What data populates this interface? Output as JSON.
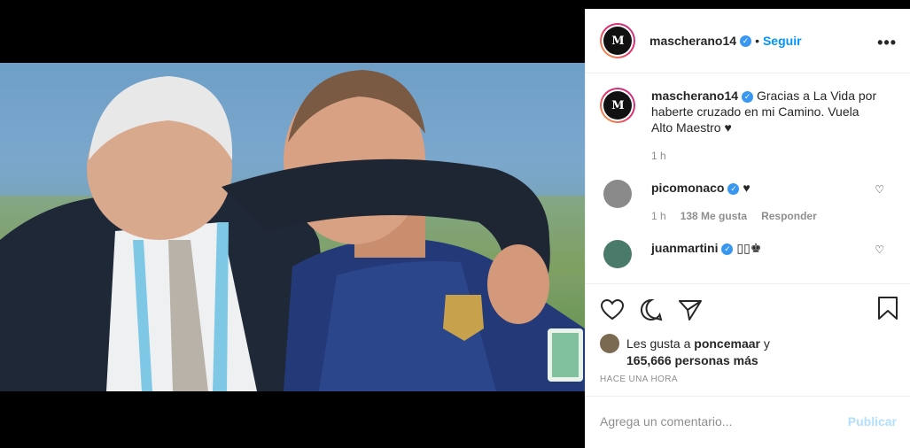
{
  "header": {
    "avatar_text": "M",
    "username": "mascherano14",
    "separator": "•",
    "follow_label": "Seguir",
    "more_label": "•••"
  },
  "caption": {
    "username": "mascherano14",
    "text": "Gracias a La Vida por haberte cruzado en mi Camino. Vuela Alto Maestro ♥",
    "time": "1 h"
  },
  "comments": [
    {
      "username": "picomonaco",
      "text": "♥",
      "time": "1 h",
      "likes": "138 Me gusta",
      "reply": "Responder"
    },
    {
      "username": "juanmartini",
      "text": "▯▯♚"
    }
  ],
  "likes": {
    "prefix": "Les gusta a ",
    "user": "poncemaar",
    "connector": " y",
    "count": "165,666 personas más"
  },
  "posted_time": "HACE UNA HORA",
  "comment_box": {
    "placeholder": "Agrega un comentario...",
    "publish_label": "Publicar"
  },
  "colors": {
    "accent": "#0095f6",
    "verified": "#3897f0",
    "publish_disabled": "#b2dffc"
  }
}
